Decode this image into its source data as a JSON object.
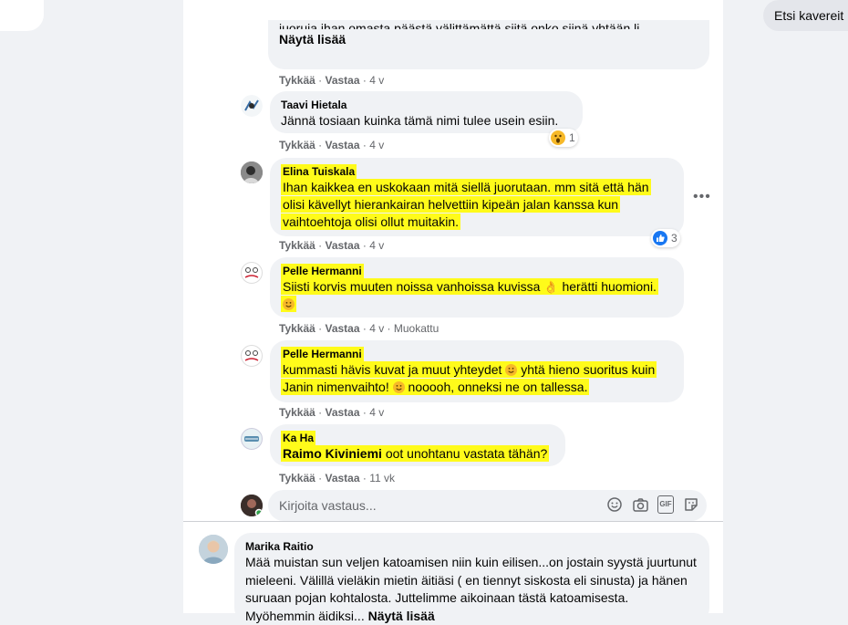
{
  "nav": {
    "search_friends": "Etsi kavereit",
    "icons": [
      "home-icon",
      "friends-icon",
      "groups-icon"
    ]
  },
  "comments": [
    {
      "author": "",
      "text": "juoruja ihan omasta päästä välittämättä siitä onko siinä yhtään li",
      "see_more": "Näytä lisää",
      "like": "Tykkää",
      "reply": "Vastaa",
      "time": "4 v"
    },
    {
      "author": "Taavi Hietala",
      "text": "Jännä tosiaan kuinka tämä nimi tulee usein esiin.",
      "like": "Tykkää",
      "reply": "Vastaa",
      "time": "4 v",
      "reaction_count": "1"
    },
    {
      "author": "Elina Tuiskala",
      "text": "Ihan kaikkea en uskokaan mitä siellä juorutaan. mm sitä että hän olisi kävellyt hierankairan helvettiin kipeän jalan kanssa kun vaihtoehtoja olisi ollut muitakin.",
      "like": "Tykkää",
      "reply": "Vastaa",
      "time": "4 v",
      "reaction_count": "3"
    },
    {
      "author": "Pelle Hermanni",
      "text_a": "Siisti korvis muuten noissa vanhoissa kuvissa",
      "text_b": "herätti huomioni.",
      "like": "Tykkää",
      "reply": "Vastaa",
      "time": "4 v",
      "edited": "Muokattu"
    },
    {
      "author": "Pelle Hermanni",
      "text_a": "kummasti hävis kuvat ja muut yhteydet",
      "text_b": "yhtä hieno suoritus kuin Janin nimenvaihto!",
      "text_c": "nooooh, onneksi ne on tallessa.",
      "like": "Tykkää",
      "reply": "Vastaa",
      "time": "4 v"
    },
    {
      "author": "Ka Ha",
      "mention": "Raimo Kiviniemi",
      "text": "oot unohtanu vastata tähän?",
      "like": "Tykkää",
      "reply": "Vastaa",
      "time": "11 vk"
    }
  ],
  "reply_box": {
    "placeholder": "Kirjoita vastaus...",
    "gif": "GIF"
  },
  "top_comment": {
    "author": "Marika Raitio",
    "text": "Mää muistan sun veljen katoamisen niin kuin eilisen...on jostain syystä juurtunut mieleeni. Välillä vieläkin mietin äitiäsi ( en tiennyt siskosta eli sinusta) ja hänen suruaan pojan kohtalosta. Juttelimme aikoinaan tästä katoamisesta. Myöhemmin äidiksi...",
    "see_more": "Näytä lisää"
  },
  "colors": {
    "highlight": "#fffb1a",
    "bubble": "#f0f2f5",
    "meta": "#65676b",
    "like_blue": "#1877f2"
  }
}
